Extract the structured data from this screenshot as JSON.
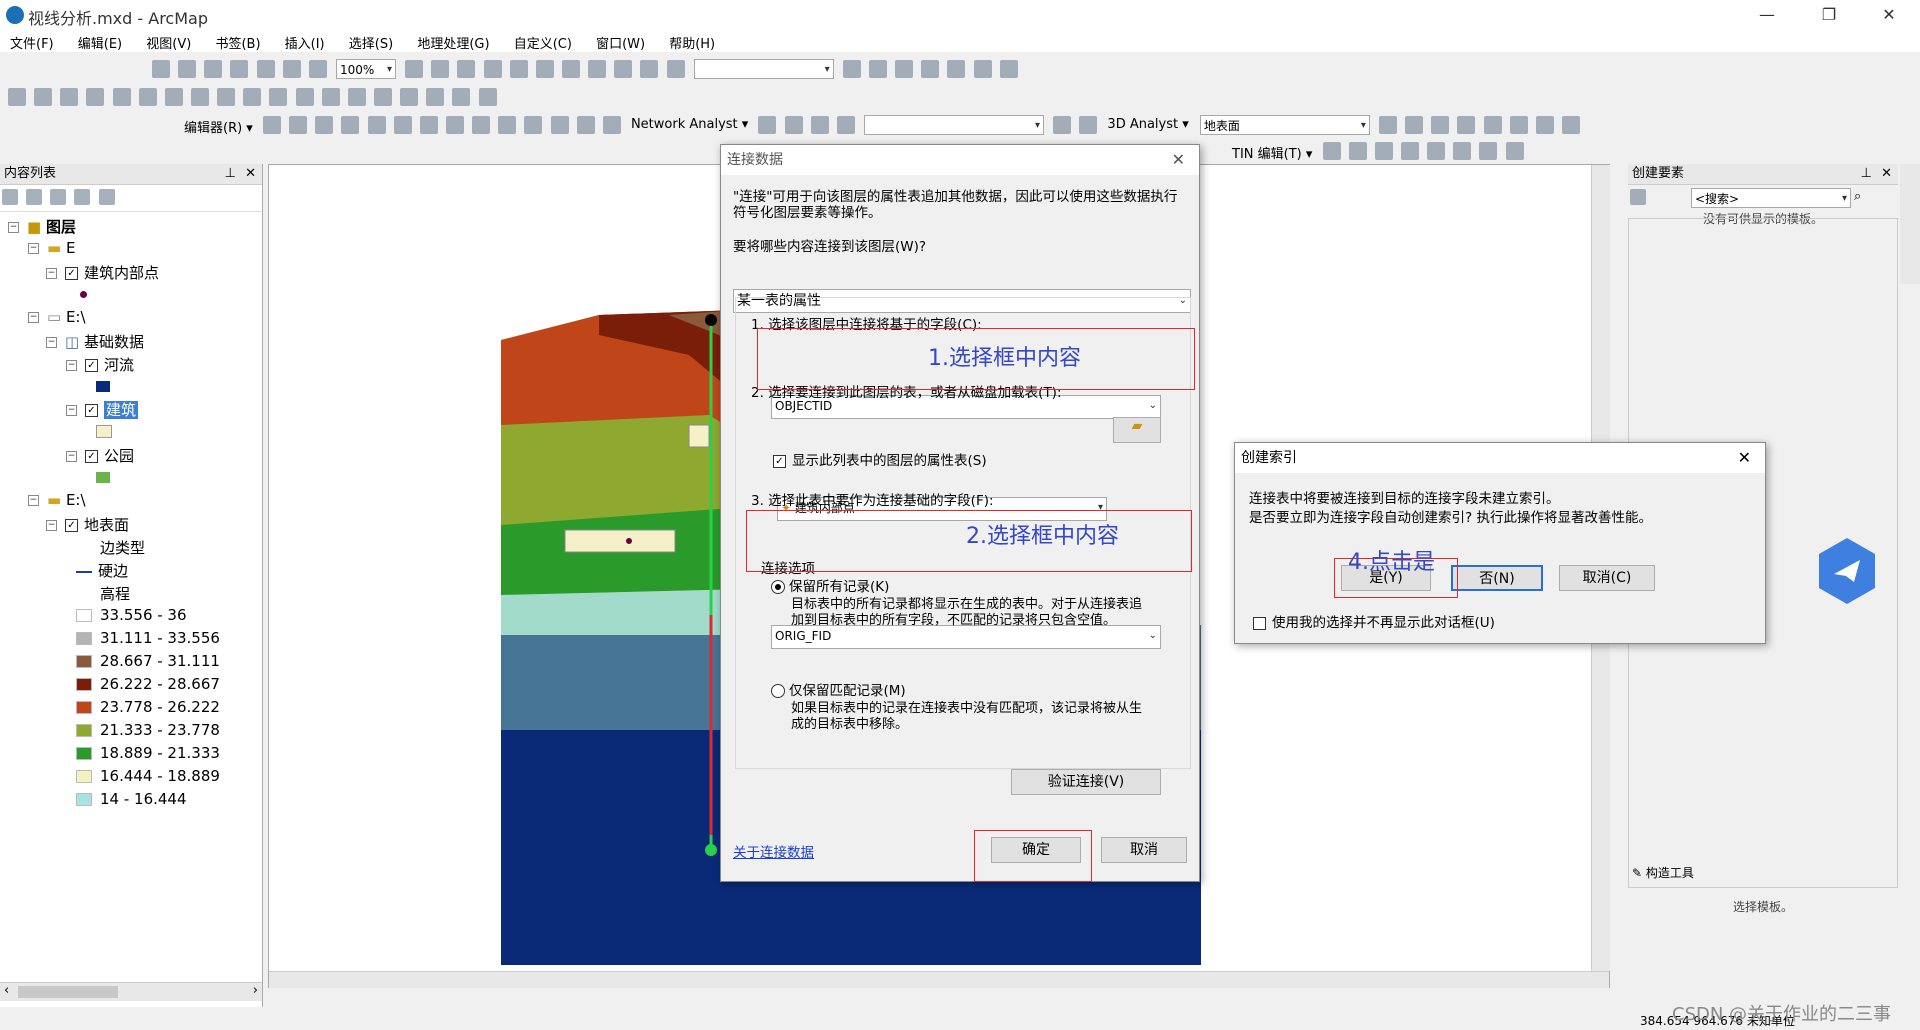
{
  "window": {
    "title": "视线分析.mxd - ArcMap",
    "minimize": "—",
    "restore": "❐",
    "close": "✕"
  },
  "menu": [
    "文件(F)",
    "编辑(E)",
    "视图(V)",
    "书签(B)",
    "插入(I)",
    "选择(S)",
    "地理处理(G)",
    "自定义(C)",
    "窗口(W)",
    "帮助(H)"
  ],
  "toolbar": {
    "zoom": "100%",
    "editor": "编辑器(R) ▾",
    "network_analyst": "Network Analyst ▾",
    "analyst_3d": "3D Analyst ▾",
    "surface_layer": "地表面",
    "tin_edit": "TIN 编辑(T) ▾"
  },
  "toc": {
    "title": "内容列表",
    "root": "图层",
    "group1": "E",
    "layer_inner": "建筑内部点",
    "group2": "E:\\",
    "base_data": "基础数据",
    "river": "河流",
    "building": "建筑",
    "park": "公园",
    "group3": "E:\\",
    "surface": "地表面",
    "edge_type": "边类型",
    "hard_edge": "硬边",
    "elevation": "高程",
    "classes": [
      {
        "label": "33.556 - 36",
        "color": "#ffffff"
      },
      {
        "label": "31.111 - 33.556",
        "color": "#b4b4b4"
      },
      {
        "label": "28.667 - 31.111",
        "color": "#8a5a3c"
      },
      {
        "label": "26.222 - 28.667",
        "color": "#7a1e0a"
      },
      {
        "label": "23.778 - 26.222",
        "color": "#c0461a"
      },
      {
        "label": "21.333 - 23.778",
        "color": "#8fa830"
      },
      {
        "label": "18.889 - 21.333",
        "color": "#2a9a2a"
      },
      {
        "label": "16.444 - 18.889",
        "color": "#f2f2c0"
      },
      {
        "label": "14 - 16.444",
        "color": "#a6e4e4"
      }
    ],
    "colors": {
      "river": "#0a2a78",
      "building": "#f6f0c8",
      "park": "#6bb34b",
      "hard_edge": "#1f3fa0"
    }
  },
  "join_dialog": {
    "title": "连接数据",
    "intro": "\"连接\"可用于向该图层的属性表追加其他数据，因此可以使用这些数据执行符号化图层要素等操作。",
    "what_label": "要将哪些内容连接到该图层(W)?",
    "what_value": "某一表的属性",
    "step1": "1. 选择该图层中连接将基于的字段(C):",
    "field1": "OBJECTID",
    "step2": "2. 选择要连接到此图层的表，或者从磁盘加载表(T):",
    "table": "建筑内部点",
    "show_attr": "显示此列表中的图层的属性表(S)",
    "step3": "3. 选择此表中要作为连接基础的字段(F):",
    "field2": "ORIG_FID",
    "options_label": "连接选项",
    "keep_all": "保留所有记录(K)",
    "keep_all_desc": "目标表中的所有记录都将显示在生成的表中。对于从连接表追加到目标表中的所有字段，不匹配的记录将只包含空值。",
    "keep_match": "仅保留匹配记录(M)",
    "keep_match_desc": "如果目标表中的记录在连接表中没有匹配项，该记录将被从生成的目标表中移除。",
    "validate": "验证连接(V)",
    "about": "关于连接数据",
    "ok": "确定",
    "cancel": "取消"
  },
  "index_dialog": {
    "title": "创建索引",
    "line1": "连接表中将要被连接到目标的连接字段未建立索引。",
    "line2": "是否要立即为连接字段自动创建索引? 执行此操作将显著改善性能。",
    "yes": "是(Y)",
    "no": "否(N)",
    "cancel": "取消(C)",
    "dont_show": "使用我的选择并不再显示此对话框(U)"
  },
  "annotations": {
    "a1": "1.选择框中内容",
    "a2": "2.选择框中内容",
    "a4": "4.点击是"
  },
  "right_panel": {
    "title": "创建要素",
    "search": "<搜索>",
    "no_templates": "没有可供显示的模板。",
    "construct_tools": "构造工具",
    "select_template": "选择模板。"
  },
  "status": {
    "coords": "384.654  964.676 未知单位",
    "watermark": "CSDN @关于作业的二三事"
  }
}
